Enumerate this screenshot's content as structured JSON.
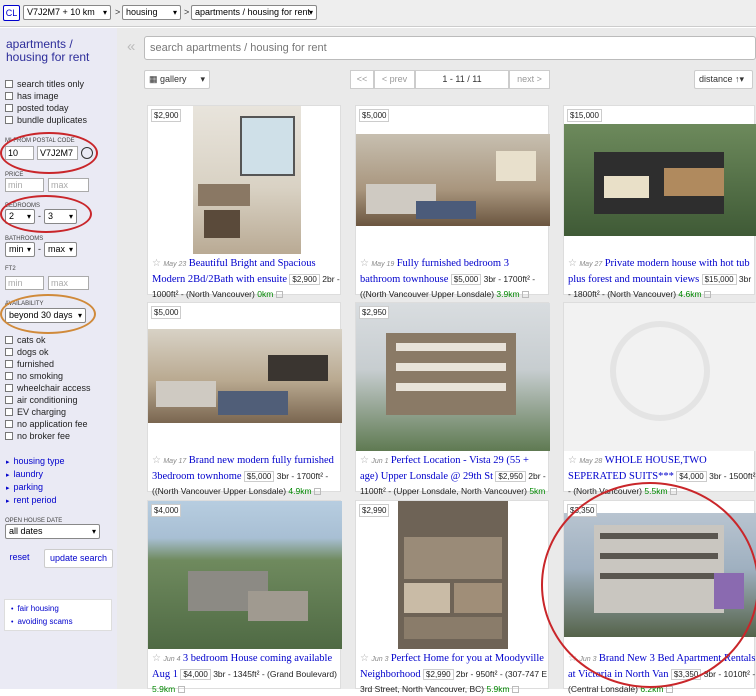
{
  "topbar": {
    "cl": "CL",
    "location": "V7J2M7 + 10 km",
    "category": "housing",
    "subcategory": "apartments / housing for rent",
    "sep": ">"
  },
  "sidebar": {
    "title": "apartments / housing for rent",
    "checks": [
      "search titles only",
      "has image",
      "posted today",
      "bundle duplicates"
    ],
    "postal_label": "MI FROM POSTAL CODE",
    "distance_val": "10",
    "postal_val": "V7J2M7",
    "price_label": "PRICE",
    "min_ph": "min",
    "max_ph": "max",
    "bedrooms_label": "BEDROOMS",
    "bed_min": "2",
    "bed_max": "3",
    "dash": "-",
    "bathrooms_label": "BATHROOMS",
    "bath_min": "min",
    "bath_max": "max",
    "ft_label": "FT2",
    "availability_label": "AVAILABILITY",
    "availability_val": "beyond 30 days",
    "amenities": [
      "cats ok",
      "dogs ok",
      "furnished",
      "no smoking",
      "wheelchair access",
      "air conditioning",
      "EV charging",
      "no application fee",
      "no broker fee"
    ],
    "links": [
      "housing type",
      "laundry",
      "parking",
      "rent period"
    ],
    "open_house_label": "OPEN HOUSE DATE",
    "open_house_val": "all dates",
    "reset": "reset",
    "update": "update search",
    "foot_links": [
      "fair housing",
      "avoiding scams"
    ]
  },
  "main": {
    "search_placeholder": "search apartments / housing for rent",
    "view": "gallery",
    "first": "<<",
    "prev": "< prev",
    "range": "1 - 11 / 11",
    "next": "next >",
    "sort": "distance ↑▾"
  },
  "listings": [
    {
      "badge": "$2,900",
      "date": "May 23",
      "title": "Beautiful Bright and Spacious Modern 2Bd/2Bath with ensuite",
      "price": "$2,900",
      "meta": "2br - 1000ft² - (North Vancouver)",
      "dist": "0km"
    },
    {
      "badge": "$5,000",
      "date": "May 19",
      "title": "Fully furnished bedroom 3 bathroom townhouse",
      "price": "$5,000",
      "meta": "3br - 1700ft² - ((North Vancouver Upper Lonsdale)",
      "dist": "3.9km"
    },
    {
      "badge": "$15,000",
      "date": "May 27",
      "title": "Private modern house with hot tub plus forest and mountain views",
      "price": "$15,000",
      "meta": "3br - 1800ft² - (North Vancouver)",
      "dist": "4.6km"
    },
    {
      "badge": "$5,000",
      "date": "May 17",
      "title": "Brand new modern fully furnished 3bedroom townhome",
      "price": "$5,000",
      "meta": "3br - 1700ft² - ((North Vancouver Upper Lonsdale)",
      "dist": "4.9km"
    },
    {
      "badge": "$2,950",
      "date": "Jun 1",
      "title": "Perfect Location - Vista 29 (55 + age) Upper Lonsdale @ 29th St",
      "price": "$2,950",
      "meta": "2br - 1100ft² - (Upper Lonsdale, North Vancouver)",
      "dist": "5km"
    },
    {
      "badge": "",
      "date": "May 28",
      "title": "WHOLE HOUSE,TWO SEPERATED SUITS***",
      "price": "$4,000",
      "meta": "3br - 1500ft² - (North Vancouver)",
      "dist": "5.5km"
    },
    {
      "badge": "$4,000",
      "date": "Jun 4",
      "title": "3 bedroom House coming available Aug 1",
      "price": "$4,000",
      "meta": "3br - 1345ft² - (Grand Boulevard)",
      "dist": "5.9km"
    },
    {
      "badge": "$2,990",
      "date": "Jun 3",
      "title": "Perfect Home for you at Moodyville Neighborhood",
      "price": "$2,990",
      "meta": "2br - 950ft² - (307-747 E 3rd Street, North Vancouver, BC)",
      "dist": "5.9km"
    },
    {
      "badge": "$3,350",
      "date": "Jun 3",
      "title": "Brand New 3 Bed Apartment Rentals at Victoria in North Van",
      "price": "$3,350",
      "meta": "3br - 1010ft² - (Central Lonsdale)",
      "dist": "6.2km"
    }
  ]
}
